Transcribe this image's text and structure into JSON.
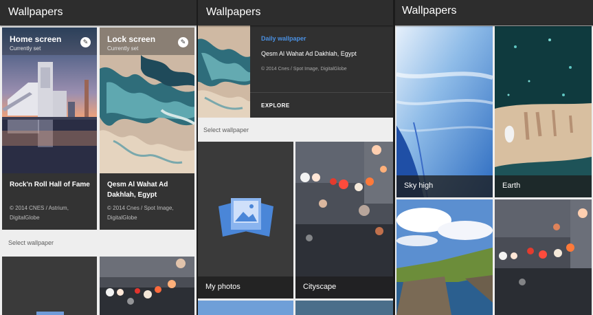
{
  "panels": [
    {
      "title": "Wallpapers",
      "home": {
        "label": "Home screen",
        "status": "Currently set",
        "name": "Rock'n Roll Hall of Fame",
        "attribution": "© 2014 CNES / Astrium, DigitalGlobe"
      },
      "lock": {
        "label": "Lock screen",
        "status": "Currently set",
        "name": "Qesm Al Wahat Ad Dakhlah, Egypt",
        "attribution": "© 2014 Cnes / Spot Image, DigitalGlobe"
      },
      "select_label": "Select wallpaper"
    },
    {
      "title": "Wallpapers",
      "daily": {
        "kicker": "Daily wallpaper",
        "name": "Qesm Al Wahat Ad Dakhlah, Egypt",
        "attribution": "© 2014 Cnes / Spot Image, DigitalGlobe",
        "action": "EXPLORE"
      },
      "select_label": "Select wallpaper",
      "tiles": [
        "My photos",
        "Cityscape"
      ]
    },
    {
      "title": "Wallpapers",
      "tiles": [
        "Sky high",
        "Earth"
      ]
    }
  ],
  "icons": {
    "edit": "pencil-icon",
    "photos": "photos-icon"
  }
}
